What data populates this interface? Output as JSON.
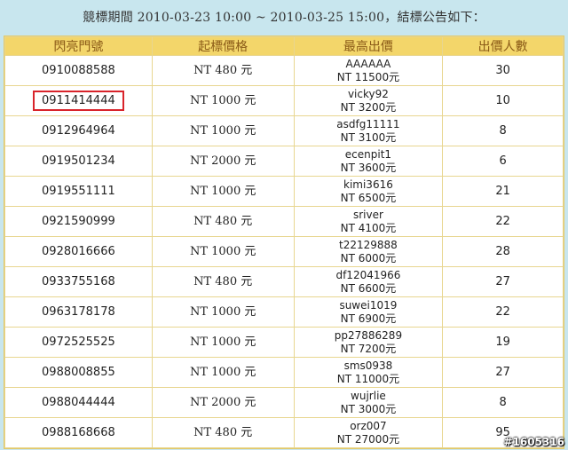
{
  "header": {
    "title": "競標期間 2010-03-23 10:00 ~ 2010-03-25 15:00，結標公告如下："
  },
  "table": {
    "headers": [
      "閃亮門號",
      "起標價格",
      "最高出價",
      "出價人數"
    ],
    "rows": [
      {
        "number": "0910088588",
        "start": "NT 480 元",
        "user": "AAAAAA",
        "amount": "NT 11500元",
        "bidders": "30"
      },
      {
        "number": "0911414444",
        "start": "NT 1000 元",
        "user": "vicky92",
        "amount": "NT 3200元",
        "bidders": "10"
      },
      {
        "number": "0912964964",
        "start": "NT 1000 元",
        "user": "asdfg11111",
        "amount": "NT 3100元",
        "bidders": "8"
      },
      {
        "number": "0919501234",
        "start": "NT 2000 元",
        "user": "ecenpit1",
        "amount": "NT 3600元",
        "bidders": "6"
      },
      {
        "number": "0919551111",
        "start": "NT 1000 元",
        "user": "kimi3616",
        "amount": "NT 6500元",
        "bidders": "21"
      },
      {
        "number": "0921590999",
        "start": "NT 480 元",
        "user": "sriver",
        "amount": "NT 4100元",
        "bidders": "22"
      },
      {
        "number": "0928016666",
        "start": "NT 1000 元",
        "user": "t22129888",
        "amount": "NT 6000元",
        "bidders": "28"
      },
      {
        "number": "0933755168",
        "start": "NT 480 元",
        "user": "df12041966",
        "amount": "NT 6600元",
        "bidders": "27"
      },
      {
        "number": "0963178178",
        "start": "NT 1000 元",
        "user": "suwei1019",
        "amount": "NT 6900元",
        "bidders": "22"
      },
      {
        "number": "0972525525",
        "start": "NT 1000 元",
        "user": "pp27886289",
        "amount": "NT 7200元",
        "bidders": "19"
      },
      {
        "number": "0988008855",
        "start": "NT 1000 元",
        "user": "sms0938",
        "amount": "NT 11000元",
        "bidders": "27"
      },
      {
        "number": "0988044444",
        "start": "NT 2000 元",
        "user": "wujrlie",
        "amount": "NT 3000元",
        "bidders": "8"
      },
      {
        "number": "0988168668",
        "start": "NT 480 元",
        "user": "orz007",
        "amount": "NT 27000元",
        "bidders": "95"
      }
    ]
  },
  "highlight": {
    "row": 1,
    "color": "#d9242b"
  },
  "watermark": "#1605316"
}
